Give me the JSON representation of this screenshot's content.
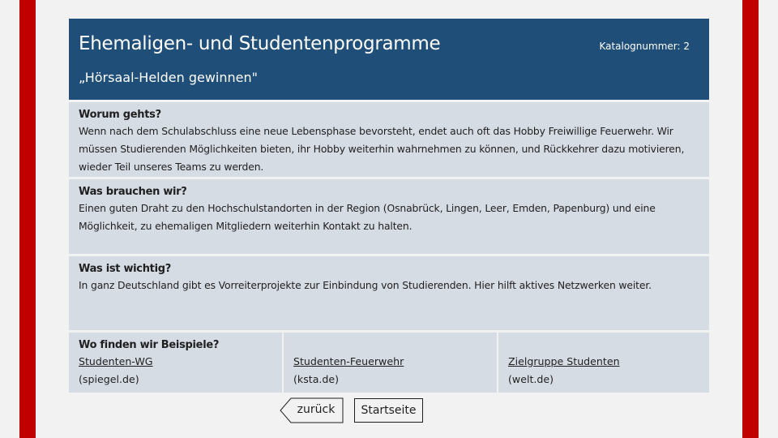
{
  "header": {
    "title": "Ehemaligen- und Studentenprogramme",
    "catalog": "Katalognummer: 2",
    "subtitle": "„Hörsaal-Helden gewinnen\""
  },
  "sections": [
    {
      "heading": "Worum gehts?",
      "body": "Wenn nach dem Schulabschluss eine neue Lebensphase bevorsteht, endet auch oft das Hobby Freiwillige Feuerwehr. Wir müssen Studierenden Möglichkeiten bieten, ihr Hobby weiterhin wahrnehmen zu können, und Rückkehrer dazu motivieren, wieder Teil unseres Teams zu werden."
    },
    {
      "heading": "Was brauchen wir?",
      "body": "Einen guten Draht zu den Hochschulstandorten in der Region (Osnabrück, Lingen, Leer, Emden, Papenburg) und eine Möglichkeit, zu ehemaligen Mitgliedern weiterhin Kontakt zu halten."
    },
    {
      "heading": "Was ist wichtig?",
      "body": "In ganz Deutschland gibt es Vorreiterprojekte zur Einbindung von Studierenden. Hier hilft aktives Netzwerken weiter."
    }
  ],
  "examples": {
    "heading": "Wo finden wir Beispiele?",
    "items": [
      {
        "link": "Studenten-WG",
        "source": "(spiegel.de)"
      },
      {
        "link": "Studenten-Feuerwehr",
        "source": "(ksta.de)"
      },
      {
        "link": "Zielgruppe Studenten",
        "source": "(welt.de)"
      }
    ]
  },
  "nav": {
    "back": "zurück",
    "home": "Startseite"
  },
  "colors": {
    "frame": "#c00000",
    "header": "#1f4e79",
    "card": "#d6dce4"
  }
}
